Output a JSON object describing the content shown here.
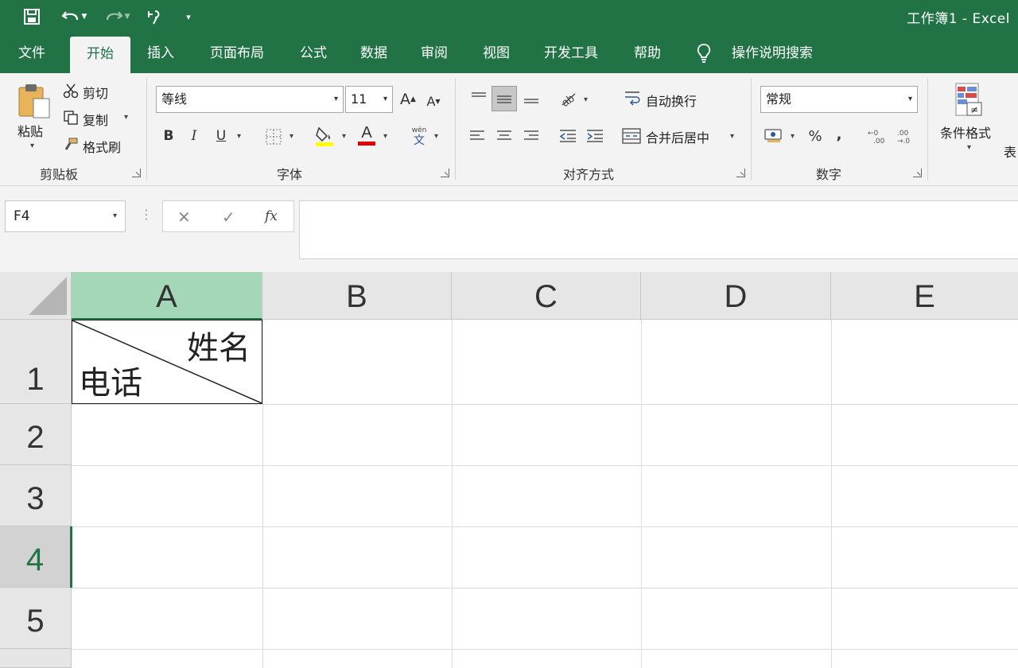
{
  "window": {
    "title": "工作簿1 - Excel"
  },
  "quick_access": {
    "icons": [
      "save-icon",
      "undo-icon",
      "redo-icon",
      "touch-mode-icon",
      "customize-icon"
    ]
  },
  "tabs": [
    {
      "label": "文件"
    },
    {
      "label": "开始",
      "active": true
    },
    {
      "label": "插入"
    },
    {
      "label": "页面布局"
    },
    {
      "label": "公式"
    },
    {
      "label": "数据"
    },
    {
      "label": "审阅"
    },
    {
      "label": "视图"
    },
    {
      "label": "开发工具"
    },
    {
      "label": "帮助"
    }
  ],
  "tell_me": {
    "label": "操作说明搜索",
    "icon": "lightbulb-icon"
  },
  "clipboard": {
    "paste": "粘贴",
    "cut": "剪切",
    "copy": "复制",
    "format_painter": "格式刷",
    "group": "剪贴板"
  },
  "font": {
    "name": "等线",
    "size": "11",
    "bold": "B",
    "italic": "I",
    "underline": "U",
    "grow": "A",
    "shrink": "A",
    "group": "字体",
    "fill_color": "#ffff00",
    "font_color": "#e00000"
  },
  "alignment": {
    "wrap": "自动换行",
    "merge": "合并后居中",
    "group": "对齐方式"
  },
  "number": {
    "format": "常规",
    "percent": "%",
    "comma": ",",
    "group": "数字"
  },
  "styles": {
    "conditional": "条件格式",
    "table_partial": "表"
  },
  "formula_bar": {
    "name_box": "F4",
    "cancel": "✕",
    "enter": "✓",
    "fx": "fx",
    "value": ""
  },
  "grid": {
    "columns": [
      "A",
      "B",
      "C",
      "D",
      "E"
    ],
    "rows": [
      "1",
      "2",
      "3",
      "4",
      "5"
    ],
    "selected_column": "A",
    "selected_row": "4",
    "cells": {
      "A1": {
        "top_right": "姓名",
        "bottom_left": "电话"
      }
    }
  },
  "colors": {
    "accent": "#217346"
  }
}
